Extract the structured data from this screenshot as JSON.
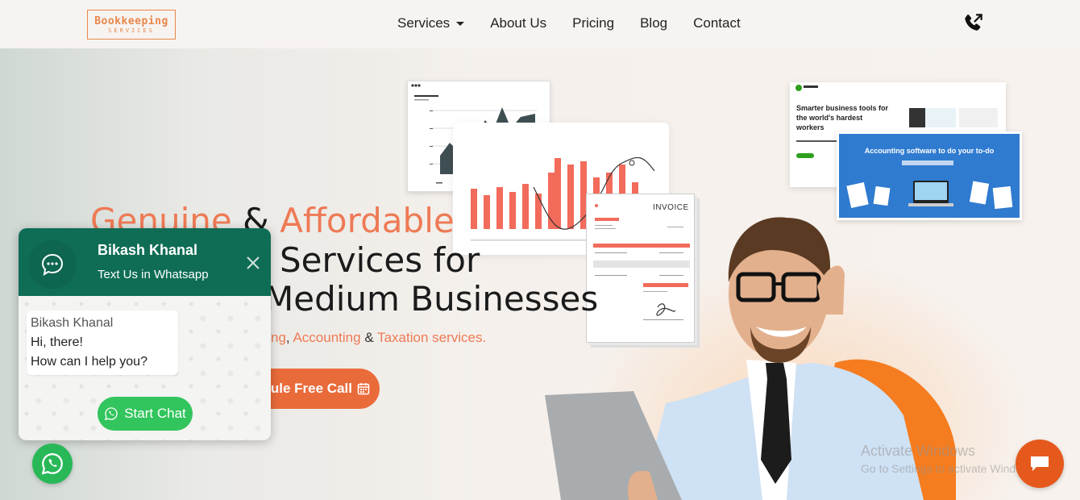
{
  "brand": {
    "logo_main": "Bookkeeping",
    "logo_sub": "SERVICES",
    "accent": "#ee7a55"
  },
  "nav": {
    "items": [
      {
        "label": "Services",
        "has_dropdown": true
      },
      {
        "label": "About Us"
      },
      {
        "label": "Pricing"
      },
      {
        "label": "Blog"
      },
      {
        "label": "Contact"
      }
    ],
    "phone_icon": "phone-outgoing-icon"
  },
  "hero": {
    "line1_a": "Genuine",
    "line1_amp": "&",
    "line1_b": "Affordable",
    "line2": "Services for",
    "line3": "Medium Businesses",
    "sub_a": "ng",
    "sub_comma": ",",
    "sub_b": "Accounting",
    "sub_amp": "&",
    "sub_c": "Taxation services.",
    "cta_label": "ule Free Call"
  },
  "illustrations": {
    "invoice_title": "INVOICE",
    "qb_headline": "Smarter business tools for the world's hardest workers",
    "qb_blue_text": "Accounting software to do your to-do"
  },
  "whatsapp": {
    "name": "Bikash Khanal",
    "subtitle": "Text Us in Whatsapp",
    "bubble_name": "Bikash Khanal",
    "bubble_line1": "Hi, there!",
    "bubble_line2": "How can I help you?",
    "start_label": "Start Chat",
    "color": "#0f6d55"
  },
  "watermark": {
    "line1": "Activate Windows",
    "line2": "Go to Settings to activate Windows."
  }
}
